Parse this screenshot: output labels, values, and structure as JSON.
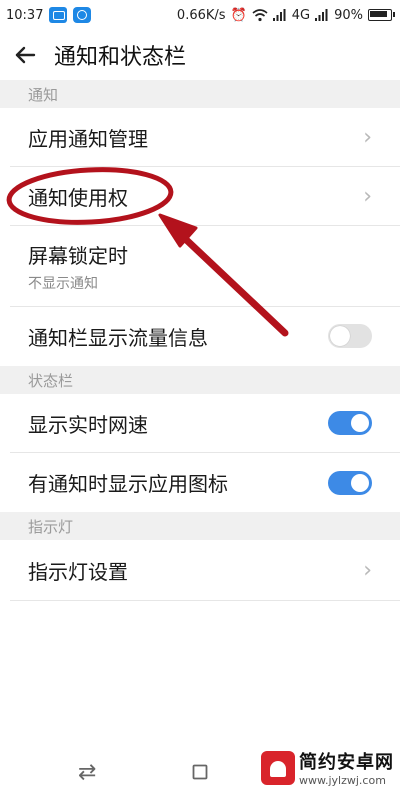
{
  "status_bar": {
    "time": "10:37",
    "speed": "0.66K/s",
    "network": "4G",
    "battery": "90%"
  },
  "header": {
    "title": "通知和状态栏"
  },
  "sections": {
    "notify": {
      "title": "通知"
    },
    "statusbar": {
      "title": "状态栏"
    },
    "indicator": {
      "title": "指示灯"
    }
  },
  "rows": {
    "app_notify": {
      "label": "应用通知管理"
    },
    "notify_access": {
      "label": "通知使用权"
    },
    "lock_screen": {
      "label": "屏幕锁定时",
      "sub": "不显示通知"
    },
    "traffic_info": {
      "label": "通知栏显示流量信息",
      "toggle": false
    },
    "realtime_speed": {
      "label": "显示实时网速",
      "toggle": true
    },
    "show_icon": {
      "label": "有通知时显示应用图标",
      "toggle": true
    },
    "indicator_settings": {
      "label": "指示灯设置"
    }
  },
  "watermark": {
    "title": "简约安卓网",
    "url": "www.jylzwj.com"
  },
  "colors": {
    "accent": "#3d8ae6",
    "annotation": "#b3121c",
    "section_bg": "#f0f0f0"
  },
  "icons": [
    "back-arrow",
    "chevron-right",
    "toggle",
    "nav-back",
    "nav-home",
    "signal",
    "wifi",
    "alarm",
    "battery"
  ]
}
